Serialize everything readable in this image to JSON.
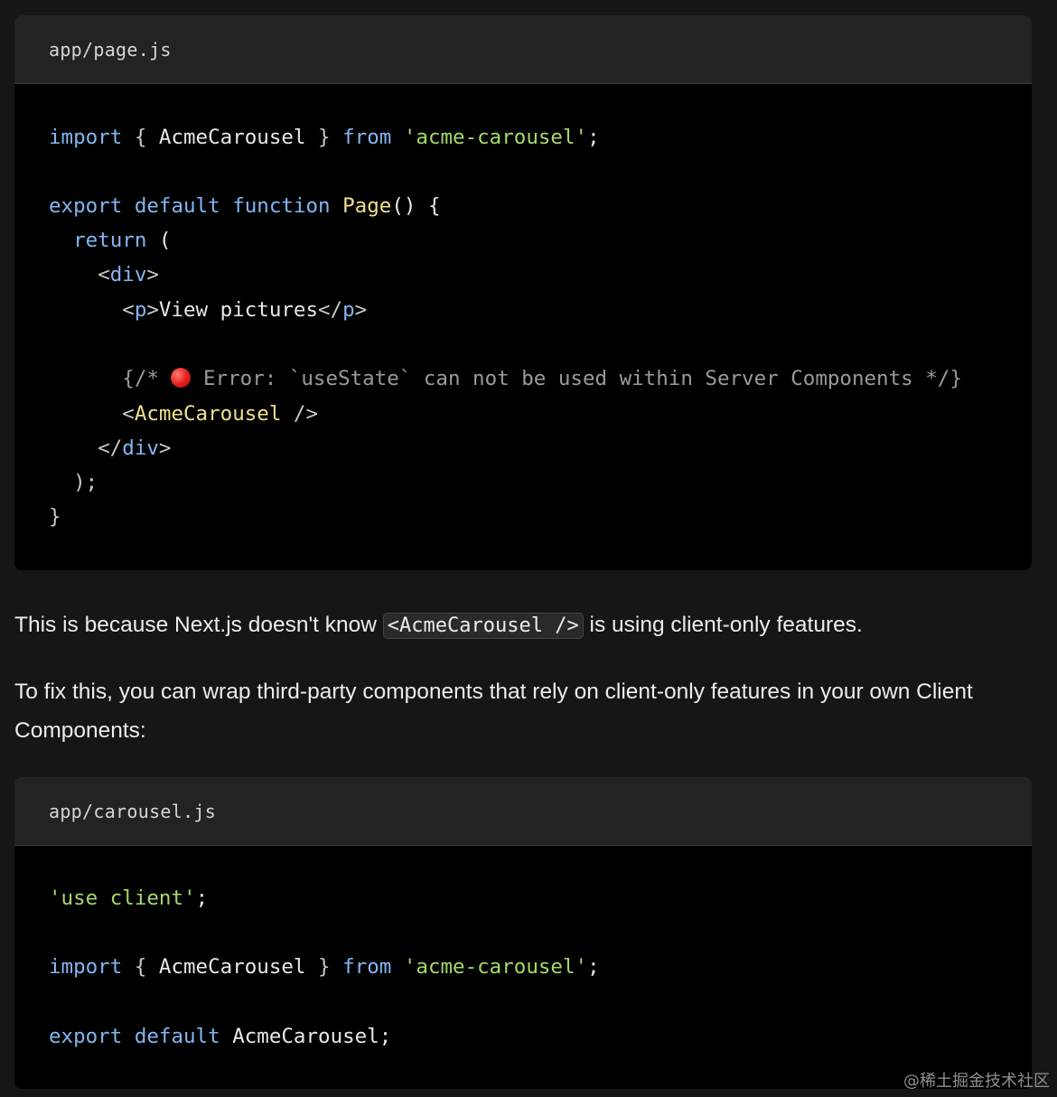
{
  "code_block_1": {
    "filename": "app/page.js",
    "lines": {
      "l1": {
        "import": "import",
        "open": " { ",
        "name": "AcmeCarousel",
        "close": " } ",
        "from": "from",
        "sp": " ",
        "module": "'acme-carousel'",
        "semi": ";"
      },
      "l2": {
        "export": "export",
        "sp1": " ",
        "default": "default",
        "sp2": " ",
        "function": "function",
        "sp3": " ",
        "name": "Page",
        "rest": "() {"
      },
      "l3": {
        "indent": "  ",
        "return": "return",
        "rest": " ("
      },
      "l4": {
        "indent": "    ",
        "open": "<",
        "tag": "div",
        "close": ">"
      },
      "l5": {
        "indent": "      ",
        "open": "<",
        "tag": "p",
        "close": ">",
        "text": "View pictures",
        "open2": "</",
        "tag2": "p",
        "close2": ">"
      },
      "l6": {
        "indent": "      ",
        "comment_start": "{/* ",
        "comment_text": " Error: `useState` can not be used within Server Components */}"
      },
      "l7": {
        "indent": "      ",
        "open": "<",
        "comp": "AcmeCarousel",
        "close": " />"
      },
      "l8": {
        "indent": "    ",
        "open": "</",
        "tag": "div",
        "close": ">"
      },
      "l9": {
        "text": "  );"
      },
      "l10": {
        "text": "}"
      }
    }
  },
  "prose_1": {
    "before": "This is because Next.js doesn't know ",
    "code": "<AcmeCarousel />",
    "after": " is using client-only features."
  },
  "prose_2": {
    "text": "To fix this, you can wrap third-party components that rely on client-only features in your own Client Components:"
  },
  "code_block_2": {
    "filename": "app/carousel.js",
    "lines": {
      "l1": {
        "str": "'use client'",
        "semi": ";"
      },
      "l2": {
        "import": "import",
        "open": " { ",
        "name": "AcmeCarousel",
        "close": " } ",
        "from": "from",
        "sp": " ",
        "module": "'acme-carousel'",
        "semi": ";"
      },
      "l3": {
        "export": "export",
        "sp1": " ",
        "default": "default",
        "rest": " AcmeCarousel;"
      }
    }
  },
  "watermark": "@稀土掘金技术社区",
  "colors": {
    "background": "#161616",
    "code_background": "#000000",
    "header_background": "#232323",
    "keyword": "#83b6f2",
    "string": "#a6d96a",
    "component": "#f0e08c",
    "comment": "#9a9a9a",
    "error_dot": "#e21b1b"
  },
  "icons": {
    "error": "red-circle-icon"
  }
}
